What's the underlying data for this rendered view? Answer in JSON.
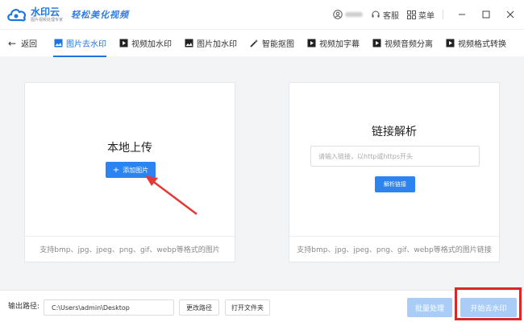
{
  "app": {
    "name": "水印云",
    "sub": "图片视频处理专家",
    "slogan": "轻松美化视频"
  },
  "titlebar": {
    "service_label": "客服",
    "menu_label": "菜单"
  },
  "nav": {
    "back_label": "返回",
    "tabs": [
      {
        "label": "图片去水印",
        "icon": "image-icon",
        "active": true
      },
      {
        "label": "视频加水印",
        "icon": "video-icon",
        "active": false
      },
      {
        "label": "图片加水印",
        "icon": "image-icon",
        "active": false
      },
      {
        "label": "智能抠图",
        "icon": "magic-wand-icon",
        "active": false
      },
      {
        "label": "视频加字幕",
        "icon": "video-icon",
        "active": false
      },
      {
        "label": "视频音频分离",
        "icon": "video-icon",
        "active": false
      },
      {
        "label": "视频格式转换",
        "icon": "video-icon",
        "active": false
      }
    ]
  },
  "upload": {
    "title": "本地上传",
    "add_button": "添加图片",
    "formats": "支持bmp、jpg、jpeg、png、gif、webp等格式的图片"
  },
  "link": {
    "title": "链接解析",
    "placeholder": "请输入链接，以http或https开头",
    "parse_button": "解析链接",
    "formats": "支持bmp、jpg、jpeg、png、gif、webp等格式的图片链接"
  },
  "bottom": {
    "output_label": "输出路径:",
    "output_path": "C:\\Users\\admin\\Desktop",
    "change_path": "更改路径",
    "open_folder": "打开文件夹",
    "batch": "批量处理",
    "start": "开始去水印"
  },
  "colors": {
    "accent": "#2b84ef",
    "highlight": "#d62a2a"
  }
}
